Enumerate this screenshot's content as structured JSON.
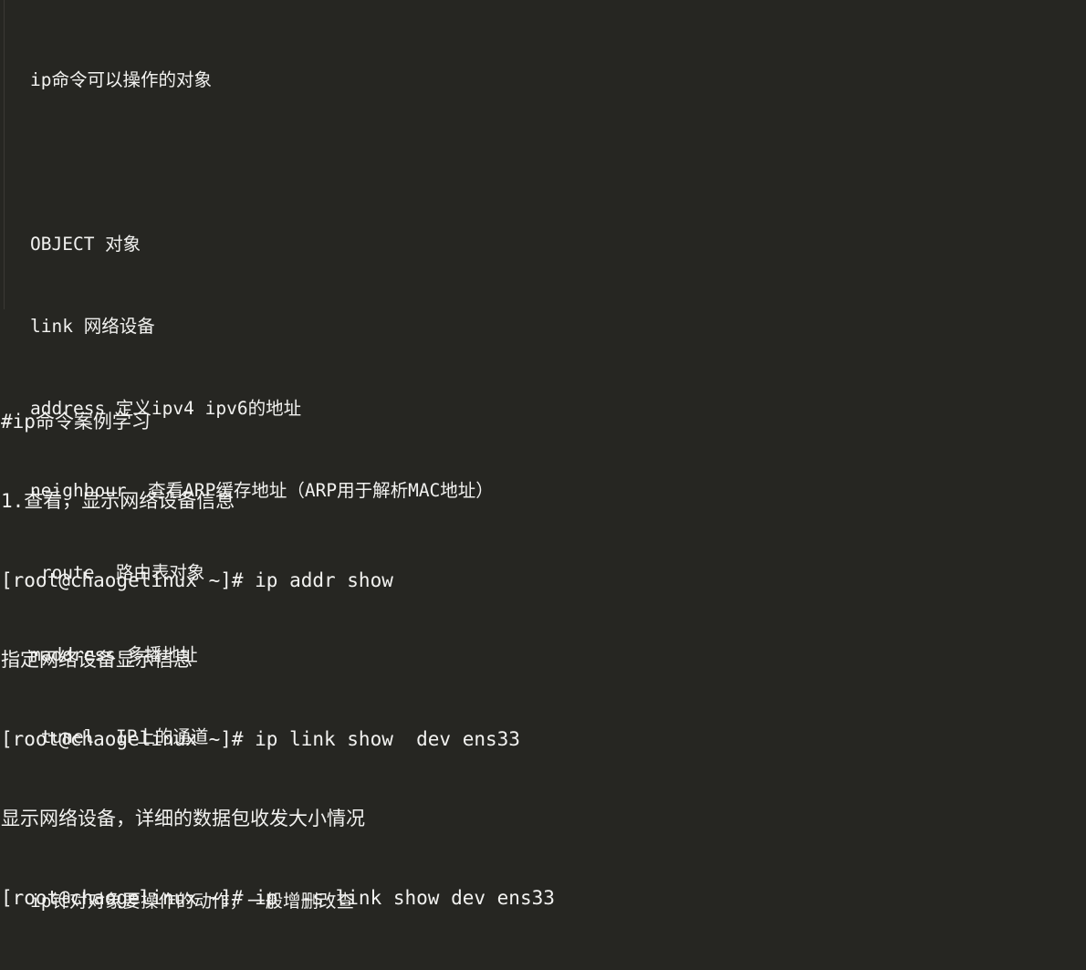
{
  "theme": {
    "background": "#262622",
    "foreground": "#f2f2f0",
    "rule_color": "#3a3934"
  },
  "note_block": {
    "heading": "ip命令可以操作的对象",
    "object_table": [
      {
        "keyword": "OBJECT",
        "description": "对象"
      },
      {
        "keyword": "link",
        "description": "网络设备"
      },
      {
        "keyword": "address",
        "description": "定义ipv4 ipv6的地址"
      },
      {
        "keyword": "neighbour",
        "description": "查看ARP缓存地址（ARP用于解析MAC地址）"
      },
      {
        "keyword": "route",
        "description": "路由表对象"
      },
      {
        "keyword": "maddress",
        "description": "多播地址"
      },
      {
        "keyword": "tunel",
        "description": "IP上的通道"
      }
    ],
    "lines": [
      "ip命令可以操作的对象",
      "",
      "OBJECT 对象",
      "link 网络设备",
      "address 定义ipv4 ipv6的地址",
      "neighbour  查看ARP缓存地址（ARP用于解析MAC地址）",
      " route  路由表对象",
      "maddress 多播地址",
      " tunel  IP上的通道",
      "",
      "ip针对对象要操作的动作，一般增删改查"
    ],
    "footer": "ip针对对象要操作的动作，一般增删改查"
  },
  "terminal_block": {
    "section_title": "#ip命令案例学习",
    "item_number": "1.查看，显示网络设备信息",
    "prompt": "[root@chaogelinux ~]#",
    "lines": [
      "#ip命令案例学习",
      "1.查看，显示网络设备信息",
      "[root@chaogelinux ~]# ip addr show",
      "指定网络设备显示信息",
      "[root@chaogelinux ~]# ip link show  dev ens33",
      "显示网络设备，详细的数据包收发大小情况",
      "[root@chaogelinux ~]# ip  -s link show dev ens33"
    ],
    "commands": [
      {
        "comment": "1.查看，显示网络设备信息",
        "command": "ip addr show"
      },
      {
        "comment": "指定网络设备显示信息",
        "command": "ip link show  dev ens33"
      },
      {
        "comment": "显示网络设备，详细的数据包收发大小情况",
        "command": "ip  -s link show dev ens33"
      }
    ]
  }
}
